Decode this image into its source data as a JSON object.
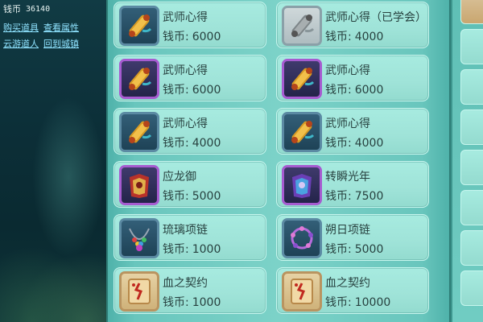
{
  "hud": {
    "money_label": "钱币",
    "money_value": "36140",
    "links_row1": [
      "购买道具",
      "查看属性"
    ],
    "links_row2": [
      "云游道人",
      "回到城镇"
    ]
  },
  "currency_label": "钱币:",
  "items": [
    {
      "name": "武师心得",
      "price": "6000",
      "icon": "gold-scroll-icon",
      "rarity": "blue"
    },
    {
      "name": "武师心得（已学会）",
      "price": "4000",
      "icon": "gray-scroll-icon",
      "rarity": "gray"
    },
    {
      "name": "武师心得",
      "price": "6000",
      "icon": "gold-scroll-icon",
      "rarity": "purple"
    },
    {
      "name": "武师心得",
      "price": "6000",
      "icon": "gold-scroll-icon",
      "rarity": "purple"
    },
    {
      "name": "武师心得",
      "price": "4000",
      "icon": "gold-scroll-icon",
      "rarity": "blue"
    },
    {
      "name": "武师心得",
      "price": "4000",
      "icon": "gold-scroll-icon",
      "rarity": "blue"
    },
    {
      "name": "应龙御",
      "price": "5000",
      "icon": "red-armor-icon",
      "rarity": "purple"
    },
    {
      "name": "转瞬光年",
      "price": "7500",
      "icon": "blue-armor-icon",
      "rarity": "purple"
    },
    {
      "name": "琉璃项链",
      "price": "1000",
      "icon": "glass-necklace-icon",
      "rarity": "blue"
    },
    {
      "name": "朔日项链",
      "price": "5000",
      "icon": "purple-necklace-icon",
      "rarity": "blue"
    },
    {
      "name": "血之契约",
      "price": "1000",
      "icon": "contract-paper-icon",
      "rarity": "tan"
    },
    {
      "name": "血之契约",
      "price": "10000",
      "icon": "contract-paper-icon",
      "rarity": "tan"
    }
  ],
  "colors": {
    "panel": "#7cd2c8",
    "card": "#a7ebe0",
    "text": "#27413f",
    "link": "#8fe3ff",
    "frame_blue": "#5b8aa3",
    "frame_purple": "#a65bd0"
  }
}
